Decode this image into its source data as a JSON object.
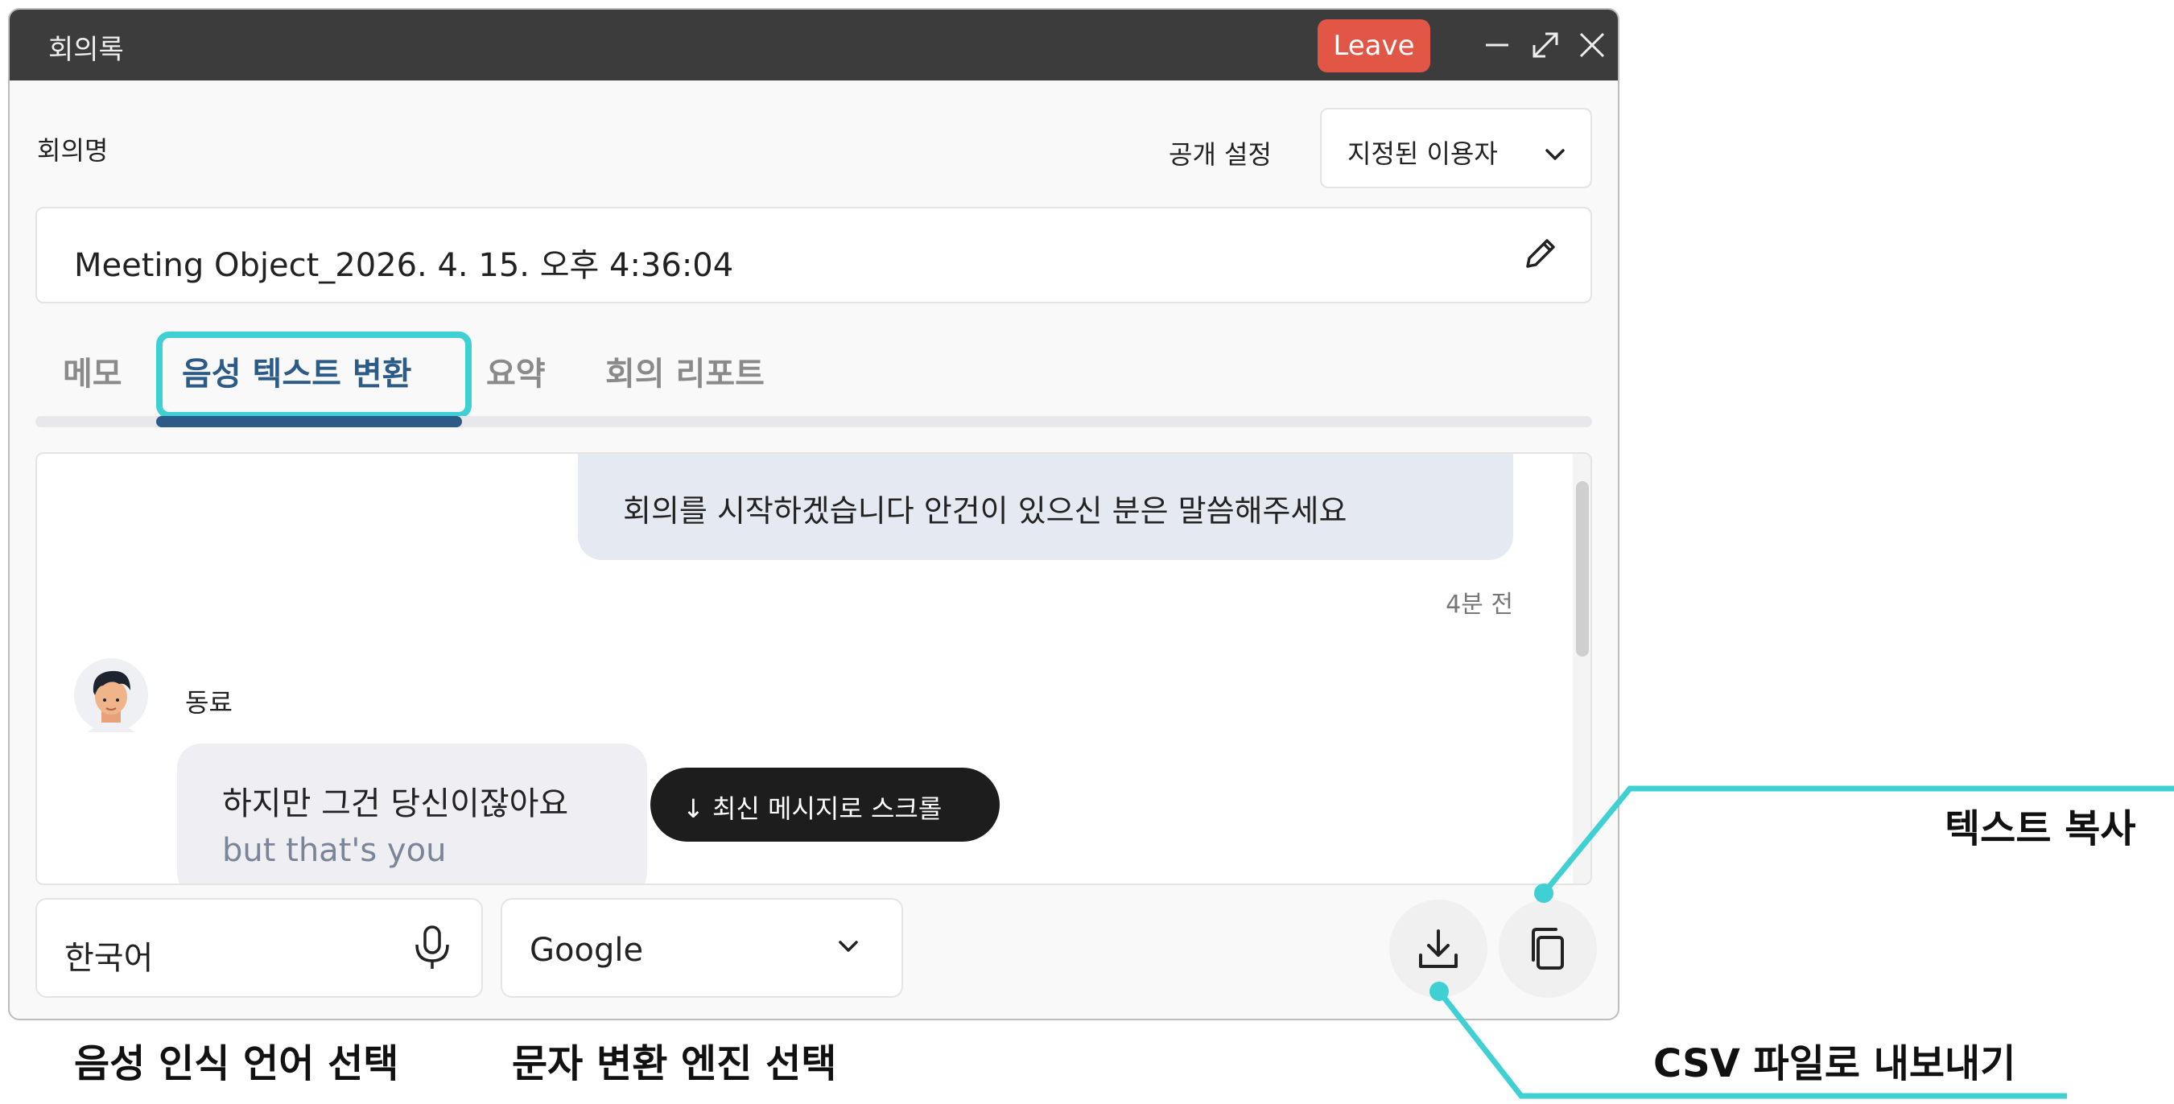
{
  "window": {
    "title": "회의록",
    "leave_label": "Leave"
  },
  "meeting": {
    "name_label": "회의명",
    "visibility_label": "공개 설정",
    "visibility_value": "지정된 이용자",
    "name_value": "Meeting Object_2026. 4. 15. 오후 4:36:04"
  },
  "tabs": [
    {
      "label": "메모"
    },
    {
      "label": "음성 텍스트 변환"
    },
    {
      "label": "요약"
    },
    {
      "label": "회의 리포트"
    }
  ],
  "chat": {
    "messages": [
      {
        "text": "회의를 시작하겠습니다  안건이 있으신 분은 말씀해주세요",
        "time": "4분 전"
      },
      {
        "sender": "동료",
        "text": "하지만 그건 당신이잖아요",
        "translation": "but that's you"
      }
    ],
    "scroll_latest_label": "↓ 최신 메시지로 스크롤"
  },
  "controls": {
    "language_value": "한국어",
    "engine_value": "Google"
  },
  "annotations": {
    "language_select": "음성 인식 언어 선택",
    "engine_select": "문자 변환 엔진 선택",
    "copy_text": "텍스트 복사",
    "export_csv": "CSV 파일로 내보내기"
  },
  "colors": {
    "titlebar": "#3c3c3c",
    "leave": "#e25646",
    "active_tab": "#2b5b86",
    "highlight": "#3fd0d4"
  }
}
